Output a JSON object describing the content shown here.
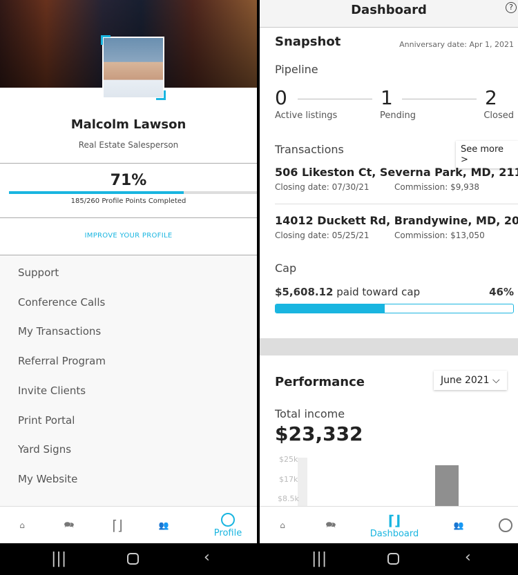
{
  "profile": {
    "name": "Malcolm Lawson",
    "role": "Real Estate Salesperson",
    "progress_percent_label": "71%",
    "progress_fraction": 0.71,
    "points_text": "185/260 Profile Points Completed",
    "improve_label": "IMPROVE YOUR PROFILE",
    "menu": [
      "Support",
      "Conference Calls",
      "My Transactions",
      "Referral Program",
      "Invite Clients",
      "Print Portal",
      "Yard Signs",
      "My Website"
    ]
  },
  "nav_left": {
    "active_label": "Profile"
  },
  "nav_right": {
    "active_label": "Dashboard"
  },
  "dashboard": {
    "title": "Dashboard",
    "help_icon": "?",
    "snapshot_title": "Snapshot",
    "anniversary": "Anniversary date: Apr 1, 2021",
    "pipeline_title": "Pipeline",
    "pipeline": [
      {
        "count": "0",
        "label": "Active listings"
      },
      {
        "count": "1",
        "label": "Pending"
      },
      {
        "count": "2",
        "label": "Closed"
      }
    ],
    "transactions_title": "Transactions",
    "see_more": "See more >",
    "transactions": [
      {
        "address": "506  Likeston Ct, Severna Park, MD, 211...",
        "closing": "Closing date: 07/30/21",
        "commission": "Commission: $9,938"
      },
      {
        "address": "14012  Duckett Rd, Brandywine, MD, 20...",
        "closing": "Closing date: 05/25/21",
        "commission": "Commission: $13,050"
      }
    ],
    "cap_title": "Cap",
    "cap_amount": "$5,608.12",
    "cap_text": "paid toward cap",
    "cap_percent_label": "46%",
    "cap_fraction": 0.46,
    "performance_title": "Performance",
    "month_select": "June 2021",
    "total_income_label": "Total income",
    "total_income": "$23,332"
  },
  "chart_data": {
    "type": "bar",
    "y_ticks": [
      "$25k",
      "$17k",
      "$8.5k"
    ],
    "bar_color": "#8f8f8f"
  },
  "colors": {
    "accent": "#19b5e0"
  }
}
